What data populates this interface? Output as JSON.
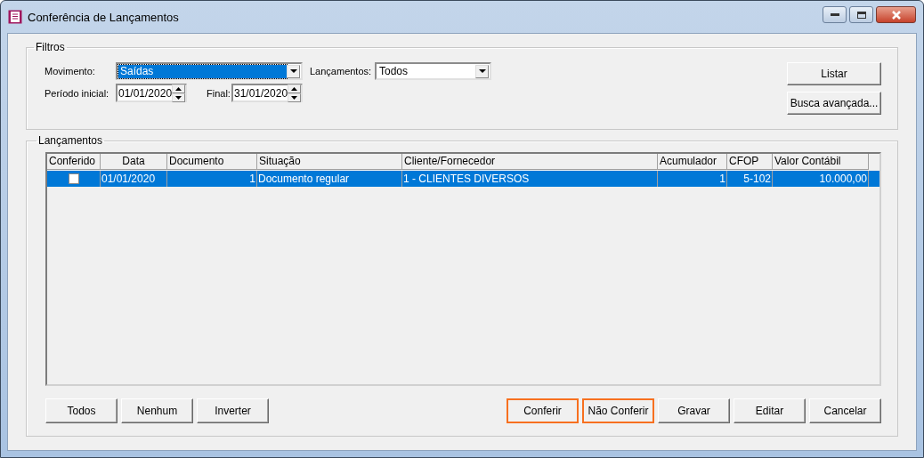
{
  "window": {
    "title": "Conferência de Lançamentos"
  },
  "filters": {
    "title": "Filtros",
    "movimento": {
      "label": "Movimento:",
      "value": "Saídas",
      "focused": true
    },
    "lancamentos": {
      "label": "Lançamentos:",
      "value": "Todos",
      "focused": false
    },
    "periodo_inicial": {
      "label": "Período inicial:",
      "value": "01/01/2020"
    },
    "final": {
      "label": "Final:",
      "value": "31/01/2020"
    },
    "buttons": [
      "Listar",
      "Busca avançada..."
    ]
  },
  "table": {
    "title": "Lançamentos",
    "columns": [
      "Conferido",
      "Data",
      "Documento",
      "Situação",
      "Cliente/Fornecedor",
      "Acumulador",
      "CFOP",
      "Valor Contábil"
    ],
    "rows": [
      {
        "selected": true,
        "checked": false,
        "cells": [
          "",
          "01/01/2020",
          "1",
          "Documento regular",
          "1 - CLIENTES DIVERSOS",
          "1",
          "5-102",
          "10.000,00"
        ]
      }
    ]
  },
  "buttons_left": [
    {
      "label": "Todos",
      "highlighted": false
    },
    {
      "label": "Nenhum",
      "highlighted": false
    },
    {
      "label": "Inverter",
      "highlighted": false
    }
  ],
  "buttons_right": [
    {
      "label": "Conferir",
      "highlighted": true
    },
    {
      "label": "Não Conferir",
      "highlighted": true
    },
    {
      "label": "Gravar",
      "highlighted": false
    },
    {
      "label": "Editar",
      "highlighted": false
    },
    {
      "label": "Cancelar",
      "highlighted": false
    }
  ]
}
